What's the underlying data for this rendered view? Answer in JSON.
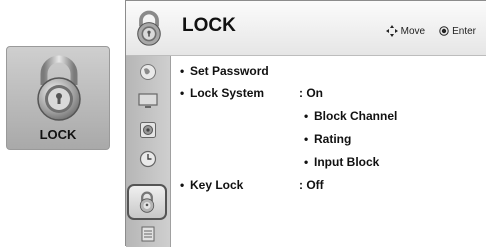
{
  "tile": {
    "label": "LOCK",
    "icon": "lock-icon"
  },
  "header": {
    "title": "LOCK",
    "hints": {
      "move_label": "Move",
      "enter_label": "Enter",
      "move_icon": "arrows-icon",
      "enter_icon": "enter-icon"
    }
  },
  "sidebar": {
    "items": [
      {
        "icon": "globe-icon"
      },
      {
        "icon": "monitor-icon"
      },
      {
        "icon": "speaker-icon"
      },
      {
        "icon": "clock-icon"
      },
      {
        "icon": "lock-icon",
        "selected": true
      },
      {
        "icon": "option-icon"
      }
    ]
  },
  "menu": {
    "set_password": "Set Password",
    "lock_system": {
      "label": "Lock System",
      "value": ": On"
    },
    "block_channel": "Block Channel",
    "rating": "Rating",
    "input_block": "Input Block",
    "key_lock": {
      "label": "Key Lock",
      "value": ": Off"
    },
    "bullet": "•"
  }
}
